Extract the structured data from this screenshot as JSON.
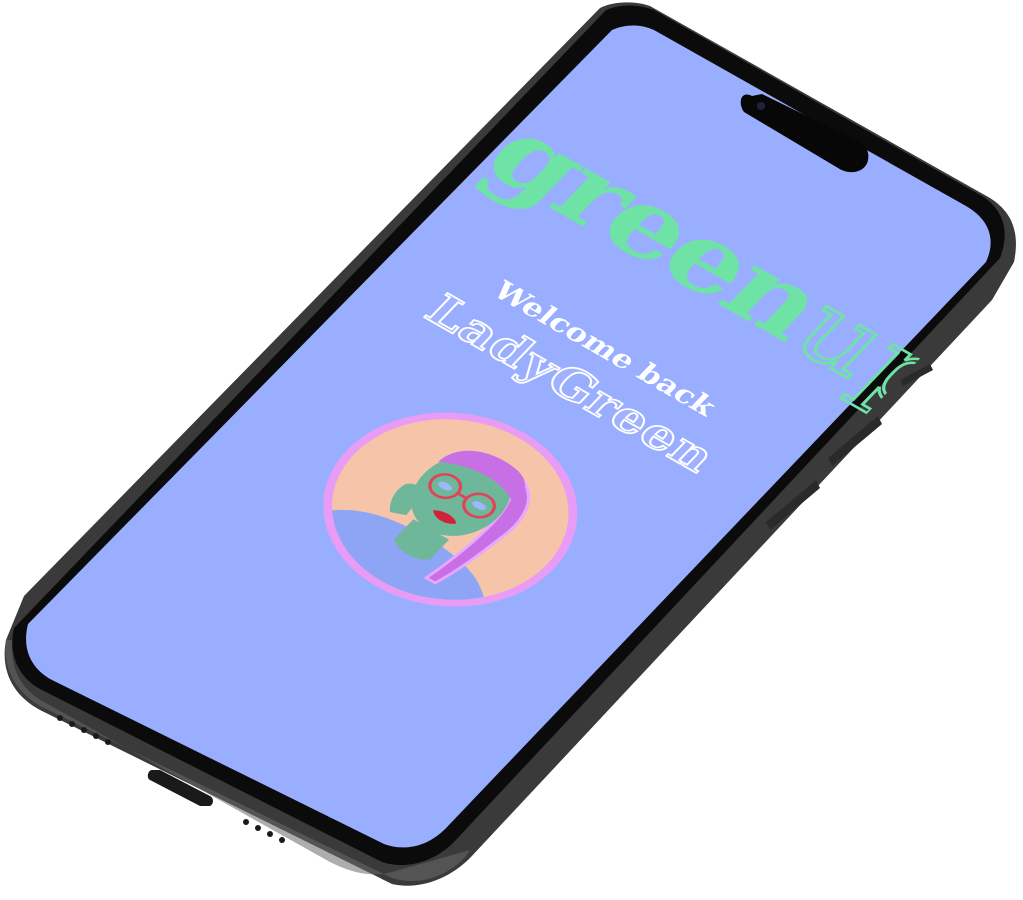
{
  "app": {
    "brand_primary": "green",
    "brand_secondary": "up"
  },
  "greeting": {
    "welcome_text": "Welcome back",
    "username": "LadyGreen"
  },
  "avatar": {
    "icon": "user-avatar-illustration"
  },
  "colors": {
    "screen_background": "#9aaeff",
    "brand_green": "#6fe3a6",
    "avatar_ring": "#e89cf5",
    "avatar_background": "#f6c4a8",
    "phone_frame": "#2b2b2b"
  }
}
